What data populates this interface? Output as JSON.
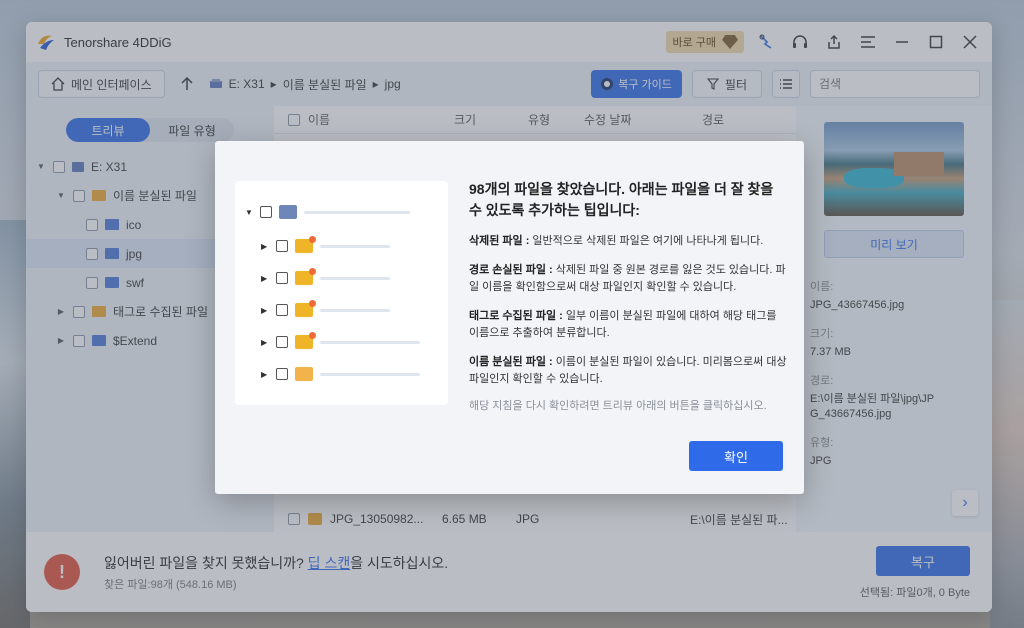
{
  "app": {
    "title": "Tenorshare 4DDiG",
    "buy_label": "바로 구매"
  },
  "toolbar": {
    "home_label": "메인 인터페이스",
    "breadcrumb": [
      "E: X31",
      "이름 분실된 파일",
      "jpg"
    ],
    "guide_label": "복구 가이드",
    "filter_label": "필터",
    "search_placeholder": "검색"
  },
  "left": {
    "tabs": [
      "트리뷰",
      "파일 유형"
    ],
    "tree": [
      {
        "label": "E: X31",
        "arrow": "▼"
      },
      {
        "label": "이름 분실된 파일",
        "arrow": "▼"
      },
      {
        "label": "ico",
        "arrow": ""
      },
      {
        "label": "jpg",
        "arrow": ""
      },
      {
        "label": "swf",
        "arrow": ""
      },
      {
        "label": "태그로 수집된 파일",
        "arrow": "▶"
      },
      {
        "label": "$Extend",
        "arrow": "▶"
      }
    ]
  },
  "list": {
    "headers": [
      "이름",
      "크기",
      "유형",
      "수정 날짜",
      "경로"
    ],
    "row": {
      "name": "JPG_13050982...",
      "size": "6.65 MB",
      "type": "JPG",
      "path": "E:\\이름 분실된 파..."
    }
  },
  "preview": {
    "button": "미리 보기",
    "name_label": "이름:",
    "name": "JPG_43667456.jpg",
    "size_label": "크기:",
    "size": "7.37 MB",
    "path_label": "경로:",
    "path": "E:\\이름 분실된 파일\\jpg\\JPG_43667456.jpg",
    "type_label": "유형:",
    "type": "JPG"
  },
  "bottom": {
    "main_prefix": "잃어버린 파일을 찾지 못했습니까? ",
    "deep_scan": "딥 스캔",
    "main_suffix": "을 시도하십시오.",
    "found": "찾은 파일:98개 (548.16 MB)",
    "recover": "복구",
    "selected": "선택됨: 파일0개, 0 Byte"
  },
  "dialog": {
    "title": "98개의 파일을 찾았습니다. 아래는 파일을 더 잘 찾을 수 있도록 추가하는 팁입니다:",
    "items": [
      {
        "term": "삭제된 파일 :",
        "desc": " 일반적으로 삭제된 파일은 여기에 나타나게 됩니다."
      },
      {
        "term": "경로 손실된 파일 :",
        "desc": " 삭제된 파일 중 원본 경로를 잃은 것도 있습니다. 파일 이름을 확인함으로써 대상 파일인지 확인할 수 있습니다."
      },
      {
        "term": "태그로 수집된 파일 :",
        "desc": " 일부 이름이 분실된 파일에 대하여 해당 태그를 이름으로 추출하여 분류합니다."
      },
      {
        "term": "이름 분실된 파일 :",
        "desc": " 이름이 분실된 파일이 있습니다. 미리봄으로써 대상 파일인지 확인할 수 있습니다."
      }
    ],
    "note": "해당 지침을 다시 확인하려면 트리뷰 아래의 버튼을 클릭하십시오.",
    "confirm": "확인"
  }
}
